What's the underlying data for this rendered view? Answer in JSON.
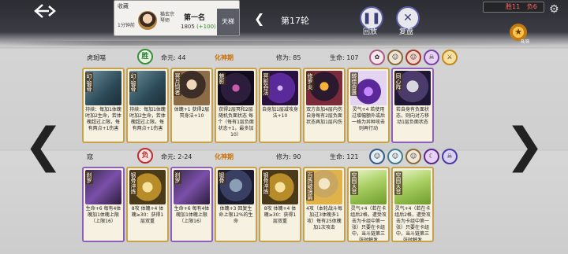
{
  "top": {
    "collect_label": "收藏",
    "pass_time": "1分钟前",
    "opponent_name": "猫玄宗 琴师",
    "rank": "第一名",
    "score": "1805",
    "score_delta": "(+100)",
    "ladder_label": "天梯",
    "round_label": "第17轮",
    "replay_label": "回放",
    "review_label": "复盘",
    "level": "胜11",
    "victory": "负6",
    "gold_count": "8/8"
  },
  "player_top": {
    "name": "虎斑喵",
    "realm_icon": "胜",
    "life_label": "命元: 44",
    "stage": "化神期",
    "cult_label": "修为: 85",
    "hp_label": "生命: 107",
    "cards": [
      {
        "title": "幻·锻骨",
        "art": "book",
        "text": "持续：每加1体魄时加2生命，若体魄超过上限，每有两点+1伤害",
        "purple": false
      },
      {
        "title": "幻·锻骨",
        "art": "book",
        "text": "持续：每加1体魄时加2生命，若体魄超过上限，每有两点+1伤害",
        "purple": false
      },
      {
        "title": "冥月饲者",
        "art": "monk",
        "text": "体魄+1 获得2层冥身法+10",
        "purple": false
      },
      {
        "title": "魅影",
        "art": "dark",
        "text": "获得2层冥和2层随机负面状态 每个（每有1层负面状态+1，最多加10）",
        "purple": false
      },
      {
        "title": "冥影吞法",
        "art": "violet",
        "text": "自身加1层减攻身法+10",
        "purple": false
      },
      {
        "title": "修罗炎",
        "art": "demon",
        "text": "双方各加4层内伤 自身每有2层负面状态再加1层内伤",
        "purple": false
      },
      {
        "title": "转佳合莲",
        "art": "purpleflame",
        "text": "灵气+4 若使用过增幅额外或后一格为异种攻击则再行动",
        "purple": false
      },
      {
        "title": "同心阵",
        "art": "cat",
        "text": "若自身有负面状态，则向对方移动1层负面状态",
        "purple": true
      }
    ]
  },
  "player_bottom": {
    "name": "寇",
    "realm_icon": "负",
    "life_label": "命元: 2-24",
    "stage": "化神期",
    "cult_label": "修为: 90",
    "hp_label": "生命: 121",
    "cards": [
      {
        "title": "刹罗",
        "art": "blade",
        "text": "生命+6 每有4体魄加1体魄上限（上限16）",
        "purple": true
      },
      {
        "title": "钢骨淬炼",
        "art": "gold",
        "text": "8攻 体魄+4 体魄≥30：获得1层双重",
        "purple": false
      },
      {
        "title": "刹罗",
        "art": "blade",
        "text": "生命+6 每有4体魄加1体魄上限（上限16）",
        "purple": true
      },
      {
        "title": "锻骨",
        "art": "beast",
        "text": "体魄+3 回复生命上限12%的生命",
        "purple": false
      },
      {
        "title": "钢骨淬炼",
        "art": "gold",
        "text": "8攻 体魄+4 体魄≥30：获得1层双重",
        "purple": false
      },
      {
        "title": "百炼破境篇",
        "art": "sage",
        "text": "4攻（本轮战斗每加过3体魄多1攻）每有25体魄加1次攻击",
        "purple": false
      },
      {
        "title": "空同天音",
        "art": "sky",
        "text": "灵气+4（若在卡组后2格，遭受攻击为卡组中第一张）只要在卡组中，当斗链第三张时触发",
        "purple": false
      },
      {
        "title": "空同天音",
        "art": "sky",
        "text": "灵气+4（若在卡组后2格，遭受攻击为卡组中第一张）只要在卡组中，当斗链第三张时触发",
        "purple": false
      }
    ]
  }
}
